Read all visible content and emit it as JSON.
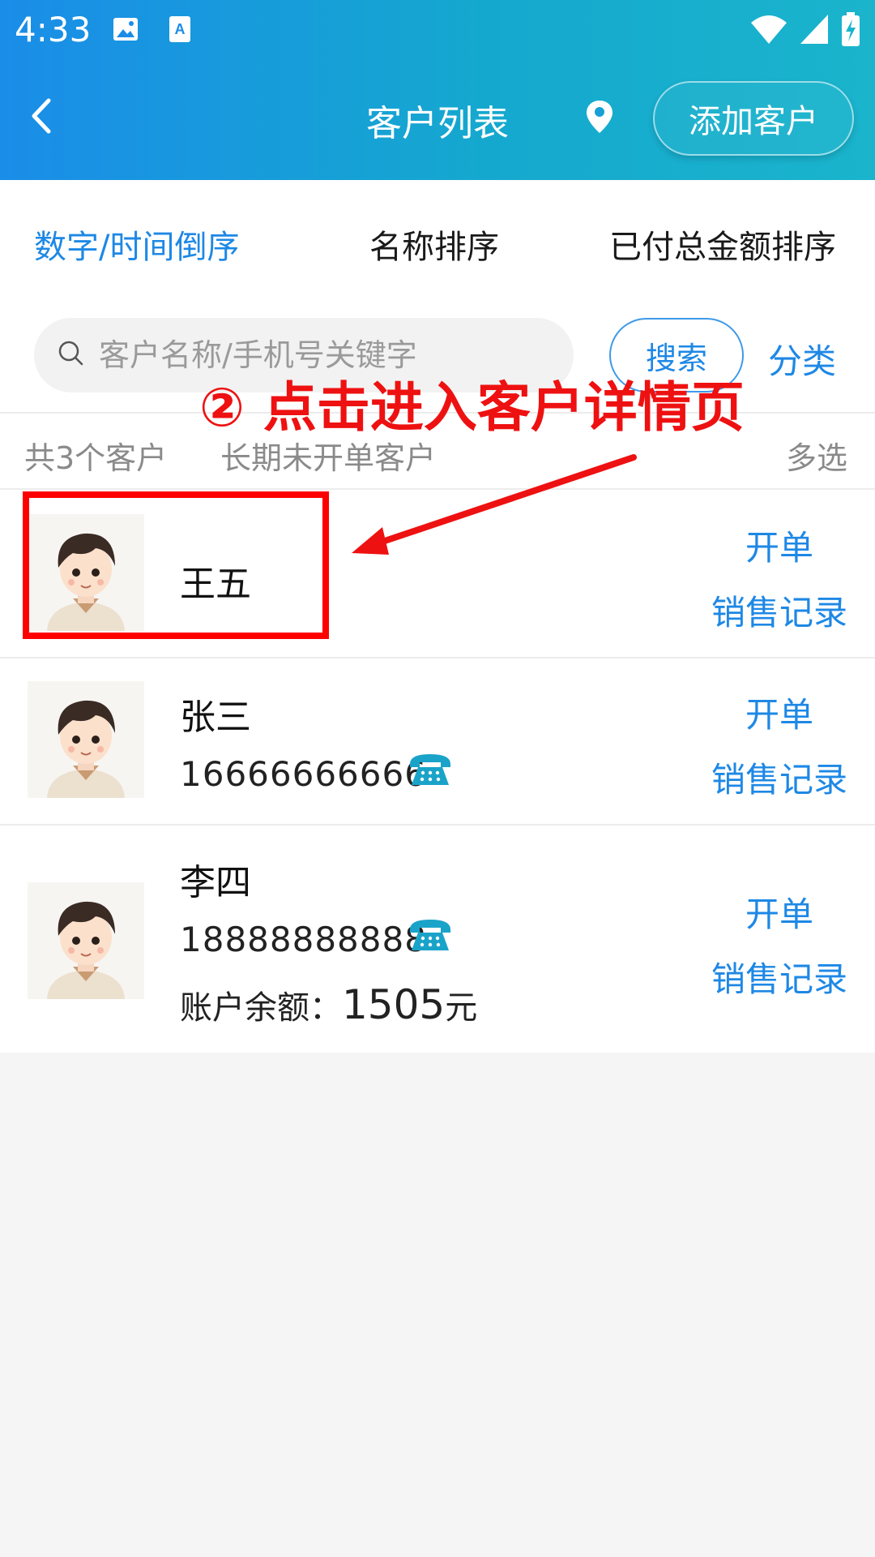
{
  "status_bar": {
    "time": "4:33"
  },
  "header": {
    "title": "客户列表",
    "add_button": "添加客户"
  },
  "sort_tabs": [
    {
      "label": "数字/时间倒序",
      "active": true
    },
    {
      "label": "名称排序",
      "active": false
    },
    {
      "label": "已付总金额排序",
      "active": false
    }
  ],
  "search": {
    "placeholder": "客户名称/手机号关键字",
    "value": "",
    "button": "搜索",
    "category": "分类"
  },
  "filters": {
    "count_label": "共3个客户",
    "long_inactive": "长期未开单客户",
    "multi_select": "多选"
  },
  "annotation": {
    "text": "② 点击进入客户详情页",
    "color": "#ee1111"
  },
  "customers": [
    {
      "name": "王五",
      "phone": "",
      "balance_label": "",
      "balance_amount": "",
      "balance_unit": "",
      "open_order": "开单",
      "sales_record": "销售记录"
    },
    {
      "name": "张三",
      "phone": "16666666666",
      "balance_label": "",
      "balance_amount": "",
      "balance_unit": "",
      "open_order": "开单",
      "sales_record": "销售记录"
    },
    {
      "name": "李四",
      "phone": "18888888888",
      "balance_label": "账户余额：",
      "balance_amount": "1505",
      "balance_unit": "元",
      "open_order": "开单",
      "sales_record": "销售记录"
    }
  ],
  "colors": {
    "accent": "#1e88e5",
    "header_gradient_start": "#1a8de8",
    "header_gradient_end": "#1ab4cc",
    "phone_icon": "#1aa3c9"
  }
}
